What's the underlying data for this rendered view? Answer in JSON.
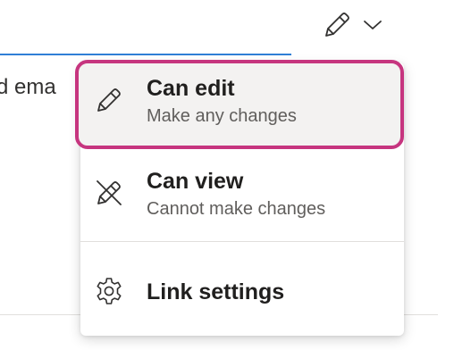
{
  "background": {
    "input_text": "d ema"
  },
  "colors": {
    "accent_underline": "#2f7fd6",
    "highlight_border": "#c6357f",
    "highlight_fill": "#f3f2f1"
  },
  "trigger": {
    "icon": "pencil-icon",
    "caret_icon": "chevron-down-icon"
  },
  "menu": {
    "items": [
      {
        "icon": "pencil-icon",
        "title": "Can edit",
        "description": "Make any changes",
        "selected": true
      },
      {
        "icon": "pencil-crossed-icon",
        "title": "Can view",
        "description": "Cannot make changes",
        "selected": false
      },
      {
        "icon": "gear-icon",
        "title": "Link settings"
      }
    ]
  }
}
